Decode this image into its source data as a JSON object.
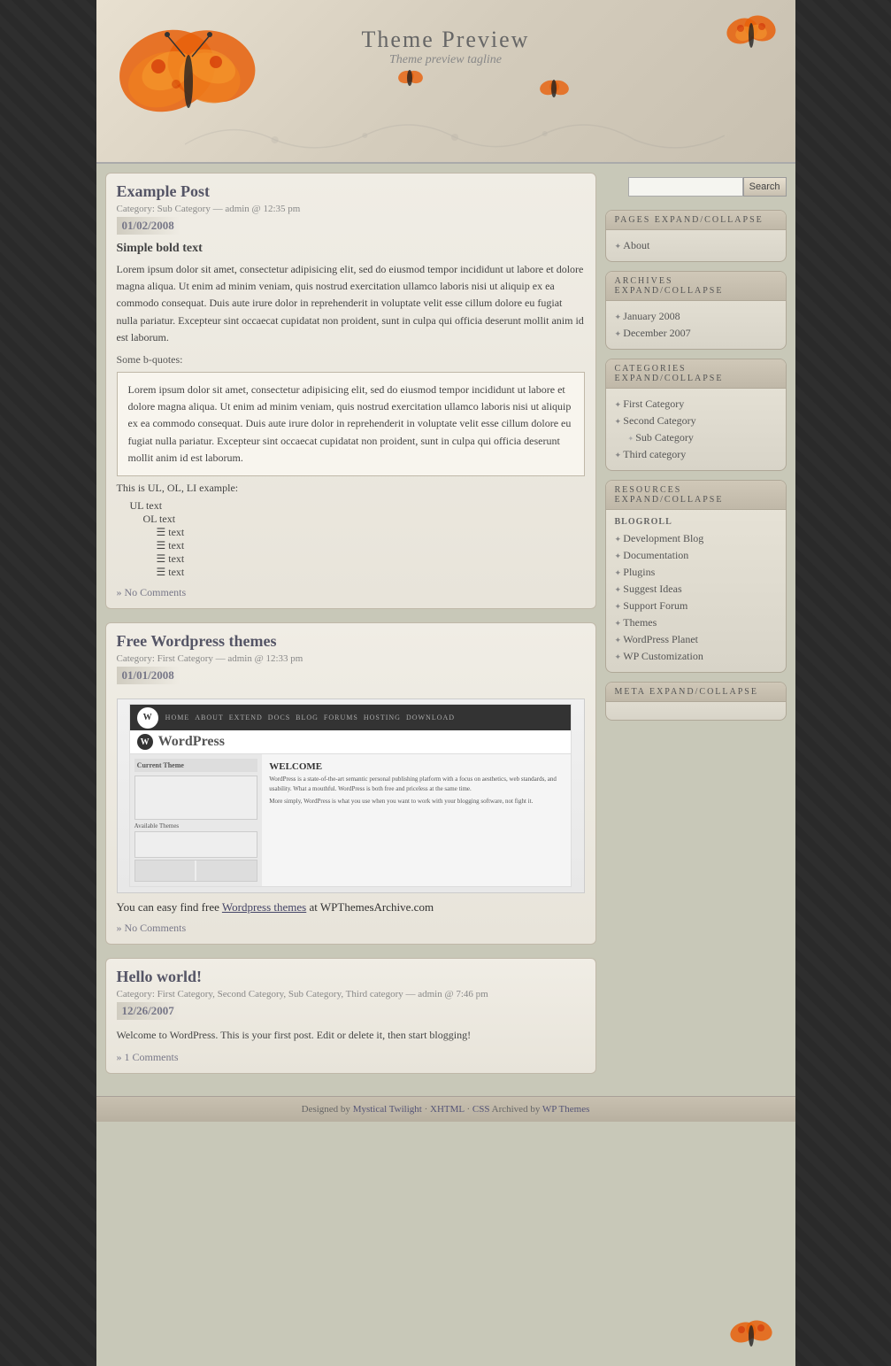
{
  "header": {
    "title": "Theme Preview",
    "tagline": "Theme preview tagline"
  },
  "search": {
    "placeholder": "",
    "button_label": "Search"
  },
  "sidebar": {
    "pages_widget": {
      "title": "PAGES EXPAND/COLLAPSE",
      "items": [
        {
          "label": "About",
          "href": "#"
        }
      ]
    },
    "archives_widget": {
      "title": "ARCHIVES EXPAND/COLLAPSE",
      "items": [
        {
          "label": "January 2008",
          "href": "#"
        },
        {
          "label": "December 2007",
          "href": "#"
        }
      ]
    },
    "categories_widget": {
      "title": "CATEGORIES EXPAND/COLLAPSE",
      "items": [
        {
          "label": "First Category",
          "href": "#",
          "sub": false
        },
        {
          "label": "Second Category",
          "href": "#",
          "sub": false
        },
        {
          "label": "Sub Category",
          "href": "#",
          "sub": true
        },
        {
          "label": "Third category",
          "href": "#",
          "sub": false
        }
      ]
    },
    "resources_widget": {
      "title": "RESOURCES EXPAND/COLLAPSE",
      "blogroll_label": "BLOGROLL",
      "items": [
        {
          "label": "Development Blog",
          "href": "#"
        },
        {
          "label": "Documentation",
          "href": "#"
        },
        {
          "label": "Plugins",
          "href": "#"
        },
        {
          "label": "Suggest Ideas",
          "href": "#"
        },
        {
          "label": "Support Forum",
          "href": "#"
        },
        {
          "label": "Themes",
          "href": "#"
        },
        {
          "label": "WordPress Planet",
          "href": "#"
        },
        {
          "label": "WP Customization",
          "href": "#"
        }
      ]
    },
    "meta_widget": {
      "title": "META EXPAND/COLLAPSE"
    }
  },
  "posts": [
    {
      "title": "Example Post",
      "meta": "Category: Sub Category — admin @ 12:35 pm",
      "date": "01/02/2008",
      "subtitle": "Simple bold text",
      "body_paragraph": "Lorem ipsum dolor sit amet, consectetur adipisicing elit, sed do eiusmod tempor incididunt ut labore et dolore magna aliqua. Ut enim ad minim veniam, quis nostrud exercitation ullamco laboris nisi ut aliquip ex ea commodo consequat. Duis aute irure dolor in reprehenderit in voluptate velit esse cillum dolore eu fugiat nulla pariatur. Excepteur sint occaecat cupidatat non proident, sunt in culpa qui officia deserunt mollit anim id est laborum.",
      "bquote_label": "Some b-quotes:",
      "blockquote": "Lorem ipsum dolor sit amet, consectetur adipisicing elit, sed do eiusmod tempor incididunt ut labore et dolore magna aliqua. Ut enim ad minim veniam, quis nostrud exercitation ullamco laboris nisi ut aliquip ex ea commodo consequat. Duis aute irure dolor in reprehenderit in voluptate velit esse cillum dolore eu fugiat nulla pariatur. Excepteur sint occaecat cupidatat non proident, sunt in culpa qui officia deserunt mollit anim id est laborum.",
      "list_label": "This is UL, OL, LI example:",
      "ul_item": "UL text",
      "ol_item": "OL text",
      "li_items": [
        "text",
        "text",
        "text",
        "text"
      ],
      "no_comments": "» No Comments"
    },
    {
      "title": "Free Wordpress themes",
      "meta": "Category: First Category — admin @ 12:33 pm",
      "date": "01/01/2008",
      "body_text": "You can easy find free",
      "link_text": "Wordpress themes",
      "link_href": "#",
      "body_text2": "at WPThemesArchive.com",
      "no_comments": "» No Comments"
    },
    {
      "title": "Hello world!",
      "meta": "Category: First Category, Second Category, Sub Category, Third category — admin @ 7:46 pm",
      "date": "12/26/2007",
      "body_paragraph": "Welcome to WordPress. This is your first post. Edit or delete it, then start blogging!",
      "no_comments": "» 1 Comments"
    }
  ],
  "footer": {
    "text": "Designed by",
    "link1_label": "Mystical Twilight",
    "separator1": "·",
    "link2_label": "XHTML",
    "separator2": "·",
    "link3_label": "CSS",
    "text2": "Archived by",
    "link4_label": "WP Themes"
  }
}
